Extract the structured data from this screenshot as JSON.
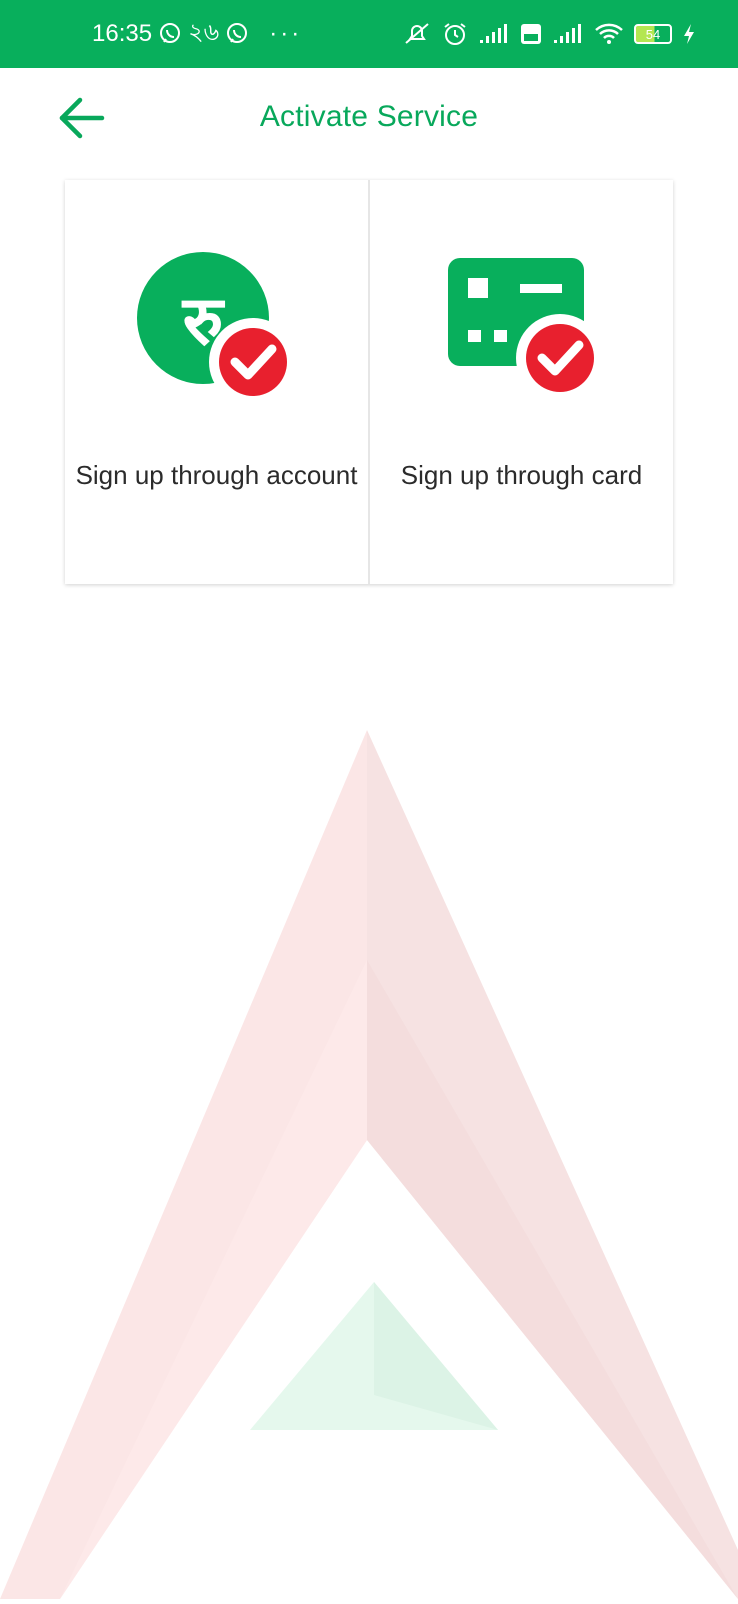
{
  "status_bar": {
    "time": "16:35",
    "bengali_number": "২৬",
    "dots": "···",
    "battery_level": "54",
    "icons": [
      "viber-icon",
      "viber-icon",
      "mute-icon",
      "alarm-icon",
      "signal-icon",
      "volte-icon",
      "signal-icon",
      "wifi-icon",
      "battery-icon",
      "charging-icon"
    ]
  },
  "header": {
    "title": "Activate Service",
    "back_icon": "arrow-left-icon"
  },
  "options": [
    {
      "label": "Sign up through account",
      "icon": "rupee-check-icon"
    },
    {
      "label": "Sign up through card",
      "icon": "card-check-icon"
    }
  ],
  "colors": {
    "primary_green": "#08af5c",
    "check_red": "#e8202e",
    "watermark_red": "#f9e4e4",
    "watermark_green": "#e3f8ec"
  }
}
